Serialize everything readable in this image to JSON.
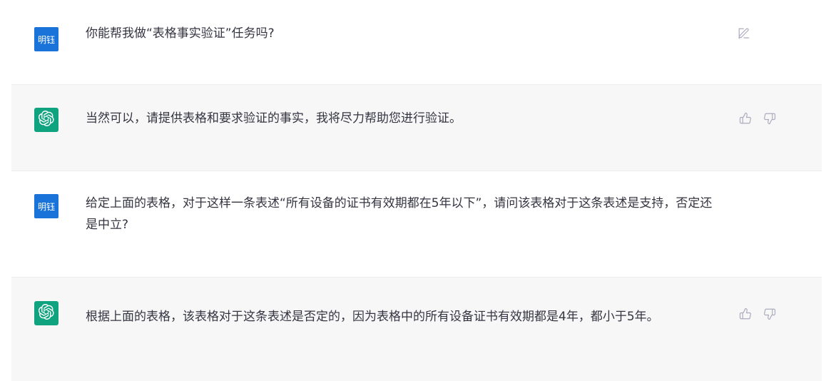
{
  "messages": [
    {
      "role": "user",
      "avatar_label": "明钰",
      "text": "你能帮我做“表格事实验证”任务吗?",
      "action_icon": "edit-icon"
    },
    {
      "role": "assistant",
      "avatar_icon": "openai-logo-icon",
      "text": "当然可以，请提供表格和要求验证的事实，我将尽力帮助您进行验证。",
      "action_icons": [
        "thumbs-up-icon",
        "thumbs-down-icon"
      ]
    },
    {
      "role": "user",
      "avatar_label": "明钰",
      "text": "给定上面的表格，对于这样一条表述“所有设备的证书有效期都在5年以下”，请问该表格对于这条表述是支持，否定还是中立?",
      "action_icon": null
    },
    {
      "role": "assistant",
      "avatar_icon": "openai-logo-icon",
      "text": "根据上面的表格，该表格对于这条表述是否定的，因为表格中的所有设备证书有效期都是4年，都小于5年。",
      "action_icons": [
        "thumbs-up-icon",
        "thumbs-down-icon"
      ]
    }
  ],
  "colors": {
    "user_avatar_bg": "#1a73d9",
    "assistant_avatar_bg": "#10a37f",
    "assistant_row_bg": "#f7f7f8",
    "icon_gray": "#acacbe",
    "text": "#343541"
  }
}
